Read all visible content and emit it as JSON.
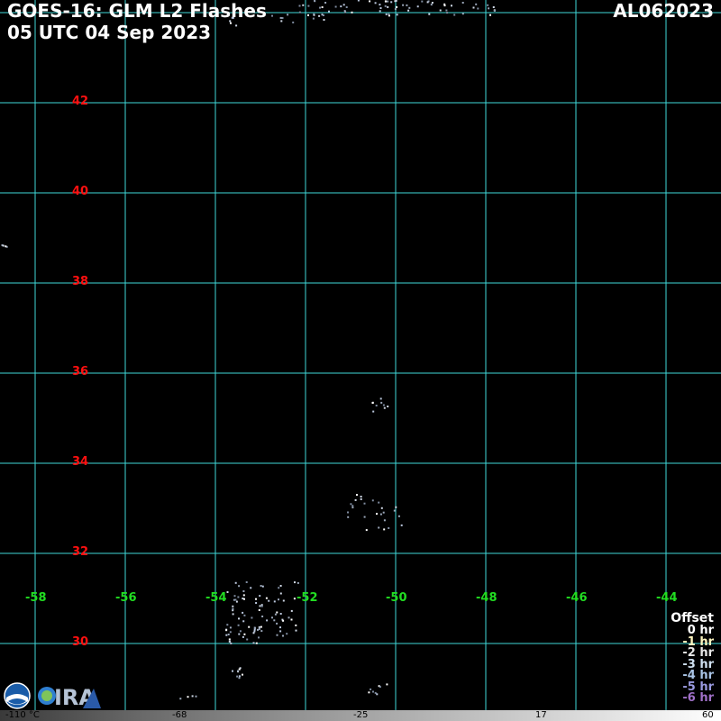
{
  "header": {
    "title_line1": "GOES-16: GLM L2 Flashes",
    "title_line2": "05 UTC 04 Sep 2023",
    "storm_id": "AL062023"
  },
  "map": {
    "lat_labels": [
      "42",
      "40",
      "38",
      "36",
      "34",
      "32",
      "30"
    ],
    "lon_labels": [
      "-58",
      "-56",
      "-54",
      "-52",
      "-50",
      "-48",
      "-46",
      "-44"
    ],
    "gridline_color": "#3fd8d8",
    "lat_label_color": "#ff1010",
    "lon_label_color": "#22dd22"
  },
  "legend": {
    "title": "Offset",
    "entries": [
      {
        "label": "0 hr",
        "color": "#ffffff"
      },
      {
        "label": "-1 hr",
        "color": "#fff7c0"
      },
      {
        "label": "-2 hr",
        "color": "#e8e8e8"
      },
      {
        "label": "-3 hr",
        "color": "#cfe0f0"
      },
      {
        "label": "-4 hr",
        "color": "#a9c4e6"
      },
      {
        "label": "-5 hr",
        "color": "#9a9ae0"
      },
      {
        "label": "-6 hr",
        "color": "#a070c8"
      }
    ]
  },
  "colorbar": {
    "labels": [
      "-110 °C",
      "-68",
      "-25",
      "17",
      "60"
    ]
  },
  "logos": {
    "icons": [
      "noaa-logo",
      "cira-logo"
    ]
  }
}
